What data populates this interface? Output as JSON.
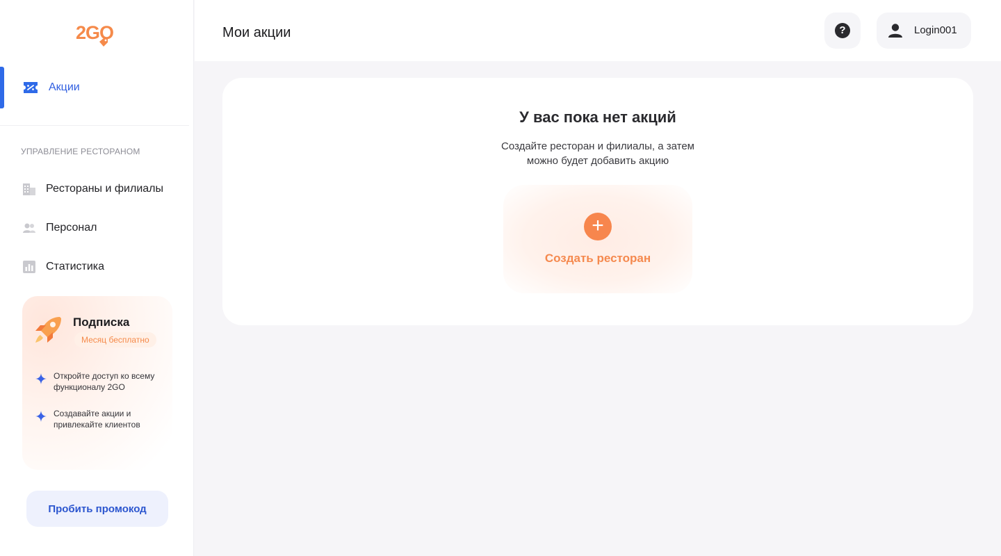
{
  "brand": {
    "logo_text": "2GO",
    "accent_color": "#f58a4a",
    "primary_color": "#2f6ae8"
  },
  "sidebar": {
    "active_item": {
      "label": "Акции",
      "icon": "discount-ticket-icon"
    },
    "section_caption": "УПРАВЛЕНИЕ РЕСТОРАНОМ",
    "items": [
      {
        "label": "Рестораны и филиалы",
        "icon": "building-icon"
      },
      {
        "label": "Персонал",
        "icon": "people-icon"
      },
      {
        "label": "Статистика",
        "icon": "bar-chart-icon"
      }
    ],
    "subscription": {
      "title": "Подписка",
      "badge": "Месяц бесплатно",
      "icon": "rocket-icon",
      "features": [
        "Откройте доступ ко всему функционалу 2GO",
        "Создавайте акции и привлекайте клиентов"
      ]
    },
    "promo_button": "Пробить промокод"
  },
  "header": {
    "title": "Мои акции",
    "help_icon": "question-icon",
    "user": {
      "name": "Login001",
      "icon": "user-icon"
    }
  },
  "main": {
    "empty_title": "У вас пока нет акций",
    "empty_subtitle": "Создайте ресторан и филиалы, а затем можно будет добавить акцию",
    "create_button": "Создать ресторан"
  }
}
